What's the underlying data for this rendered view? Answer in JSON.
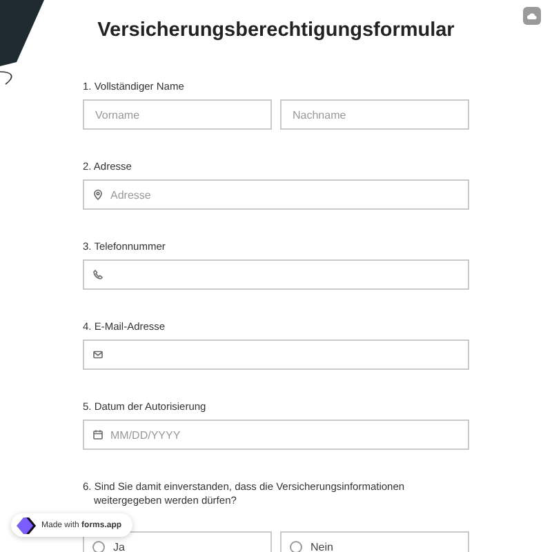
{
  "title": "Versicherungsberechtigungsformular",
  "questions": [
    {
      "label": "1.  Vollständiger Name",
      "kind": "pair",
      "fields": [
        {
          "placeholder": "Vorname"
        },
        {
          "placeholder": "Nachname"
        }
      ]
    },
    {
      "label": "2. Adresse",
      "kind": "address",
      "placeholder": "Adresse"
    },
    {
      "label": "3. Telefonnummer",
      "kind": "phone"
    },
    {
      "label": "4. E-Mail-Adresse",
      "kind": "email"
    },
    {
      "label": "5. Datum der Autorisierung",
      "kind": "date",
      "placeholder": "MM/DD/YYYY"
    },
    {
      "label": "6. Sind Sie damit einverstanden, dass die Versicherungsinformationen weitergegeben werden dürfen?",
      "kind": "radio",
      "options": [
        {
          "label": "Ja",
          "selected": false
        },
        {
          "label": "Nein",
          "selected": false
        }
      ]
    }
  ],
  "badge": {
    "prefix": "Made with",
    "brand": "forms.app"
  }
}
